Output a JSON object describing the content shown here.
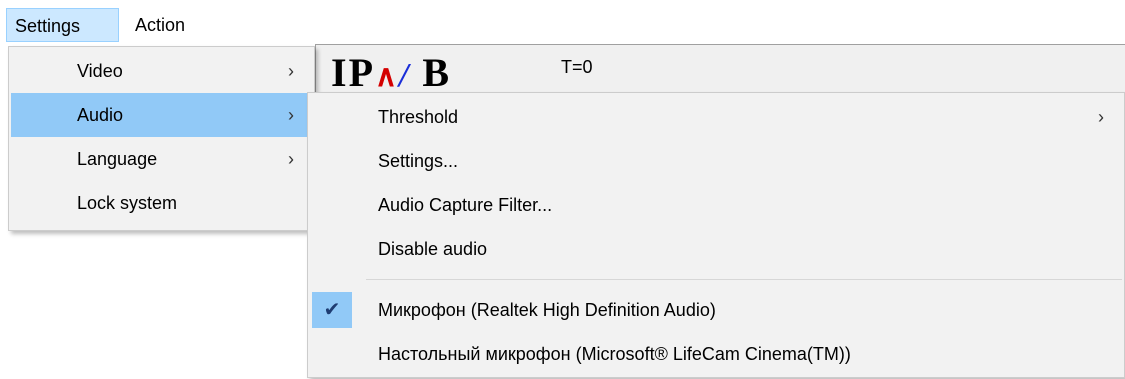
{
  "menubar": {
    "items": [
      {
        "label": "Settings"
      },
      {
        "label": "Action"
      }
    ]
  },
  "app": {
    "time_label": "T=0"
  },
  "settings_menu": {
    "items": [
      {
        "label": "Video",
        "has_submenu": true
      },
      {
        "label": "Audio",
        "has_submenu": true
      },
      {
        "label": "Language",
        "has_submenu": true
      },
      {
        "label": "Lock system",
        "has_submenu": false
      }
    ]
  },
  "audio_submenu": {
    "items": [
      {
        "label": "Threshold",
        "has_submenu": true
      },
      {
        "label": "Settings..."
      },
      {
        "label": "Audio Capture Filter..."
      },
      {
        "label": "Disable audio"
      }
    ],
    "devices": [
      {
        "label": "Микрофон (Realtek High Definition Audio)",
        "checked": true
      },
      {
        "label": "Настольный микрофон (Microsoft® LifeCam Cinema(TM))",
        "checked": false
      }
    ]
  },
  "glyphs": {
    "arrow": "›",
    "check": "✔"
  },
  "colors": {
    "highlight": "#91c9f7",
    "menubar_active": "#cce8ff",
    "menu_bg": "#f2f2f2"
  }
}
